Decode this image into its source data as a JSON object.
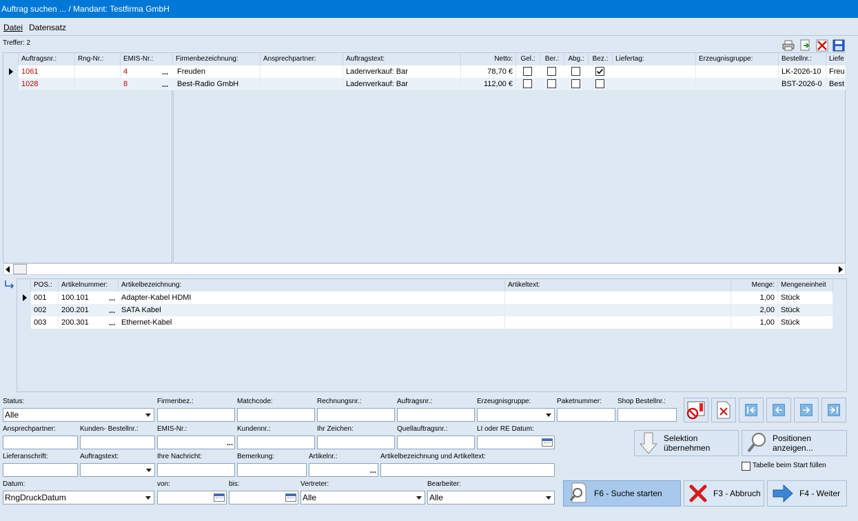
{
  "window": {
    "title": "Auftrag suchen ... / Mandant: Testfirma GmbH"
  },
  "menu": {
    "datei": "Datei",
    "datensatz": "Datensatz"
  },
  "hits": "Treffer: 2",
  "toolbar_icons": [
    "printer-icon",
    "export-icon",
    "delete-icon",
    "save-icon"
  ],
  "orders": {
    "headers": {
      "auftragsnr": "Auftragsnr.:",
      "rngnr": "Rng-Nr.:",
      "emisnr": "EMIS-Nr.:",
      "firma": "Firmenbezeichnung:",
      "ansprechpartner": "Ansprechpartner:",
      "auftragstext": "Auftragstext:",
      "netto": "Netto:",
      "gel": "Gel.:",
      "ber": "Ber.:",
      "abg": "Abg.:",
      "bez": "Bez.:",
      "liefertag": "Liefertag:",
      "erzeugnisgruppe": "Erzeugnisgruppe:",
      "bestellnr": "Bestellnr.:",
      "liefe": "Liefe"
    },
    "rows": [
      {
        "auftragsnr": "1061",
        "rngnr": "",
        "emisnr": "4",
        "ellipsis": "...",
        "firma": "Freuden",
        "ansprechpartner": "",
        "auftragstext": "Ladenverkauf: Bar",
        "netto": "78,70 €",
        "gel": false,
        "ber": false,
        "abg": false,
        "bez": true,
        "liefertag": "",
        "erzeugnisgruppe": "",
        "bestellnr": "LK-2026-10",
        "liefe": "Freu"
      },
      {
        "auftragsnr": "1028",
        "rngnr": "",
        "emisnr": "8",
        "ellipsis": "...",
        "firma": "Best-Radio GmbH",
        "ansprechpartner": "",
        "auftragstext": "Ladenverkauf: Bar",
        "netto": "112,00 €",
        "gel": false,
        "ber": false,
        "abg": false,
        "bez": false,
        "liefertag": "",
        "erzeugnisgruppe": "",
        "bestellnr": "BST-2026-0",
        "liefe": "Best"
      }
    ]
  },
  "positions": {
    "headers": {
      "pos": "POS.:",
      "artikelnummer": "Artikelnummer:",
      "bezeichnung": "Artikelbezeichnung:",
      "artikeltext": "Artikeltext:",
      "menge": "Menge:",
      "einheit": "Mengeneinheit"
    },
    "rows": [
      {
        "pos": "001",
        "artikelnummer": "100.101",
        "ellipsis": "...",
        "bezeichnung": "Adapter-Kabel HDMI",
        "artikeltext": "",
        "menge": "1,00",
        "einheit": "Stück"
      },
      {
        "pos": "002",
        "artikelnummer": "200.201",
        "ellipsis": "...",
        "bezeichnung": "SATA Kabel",
        "artikeltext": "",
        "menge": "2,00",
        "einheit": "Stück"
      },
      {
        "pos": "003",
        "artikelnummer": "200.301",
        "ellipsis": "...",
        "bezeichnung": "Ethernet-Kabel",
        "artikeltext": "",
        "menge": "1,00",
        "einheit": "Stück"
      }
    ]
  },
  "filters": {
    "status": {
      "label": "Status:",
      "value": "Alle"
    },
    "firmenbez": {
      "label": "Firmenbez.:",
      "value": ""
    },
    "matchcode": {
      "label": "Matchcode:",
      "value": ""
    },
    "rechnungsnr": {
      "label": "Rechnungsnr.:",
      "value": ""
    },
    "auftragsnr": {
      "label": "Auftragsnr.:",
      "value": ""
    },
    "erzeugnisgruppe": {
      "label": "Erzeugnisgruppe:",
      "value": ""
    },
    "paketnummer": {
      "label": "Paketnummer:",
      "value": ""
    },
    "shopbestellnr": {
      "label": "Shop Bestellnr.:",
      "value": ""
    },
    "ansprechpartner": {
      "label": "Ansprechpartner:",
      "value": ""
    },
    "kundenbestellnr": {
      "label": "Kunden- Bestellnr.:",
      "value": ""
    },
    "emisnr": {
      "label": "EMIS-Nr.:",
      "value": "",
      "button": "..."
    },
    "kundennr": {
      "label": "Kundennr.:",
      "value": ""
    },
    "ihrzeichen": {
      "label": "Ihr Zeichen:",
      "value": ""
    },
    "quellauftragsnr": {
      "label": "Quellauftragsnr.:",
      "value": ""
    },
    "liredatum": {
      "label": "LI oder RE Datum:",
      "value": ""
    },
    "lieferanschrift": {
      "label": "Lieferanschrift:",
      "value": ""
    },
    "auftragstext": {
      "label": "Auftragstext:",
      "value": ""
    },
    "ihrenachricht": {
      "label": "Ihre Nachricht:",
      "value": ""
    },
    "bemerkung": {
      "label": "Bemerkung:",
      "value": ""
    },
    "artikelnr": {
      "label": "Artikelnr.:",
      "value": "",
      "button": "..."
    },
    "artikelbez": {
      "label": "Artikelbezeichnung und Artikeltext:",
      "value": ""
    },
    "datum": {
      "label": "Datum:",
      "value": "RngDruckDatum"
    },
    "von": {
      "label": "von:",
      "value": ""
    },
    "bis": {
      "label": "bis:",
      "value": ""
    },
    "vertreter": {
      "label": "Vertreter:",
      "value": "Alle"
    },
    "bearbeiter": {
      "label": "Bearbeiter:",
      "value": "Alle"
    }
  },
  "buttons": {
    "selektion": "Selektion\nübernehmen",
    "positionen": "Positionen\nanzeigen...",
    "tabelle_fuellen": "Tabelle beim Start füllen",
    "suche": "F6 - Suche starten",
    "abbruch": "F3 - Abbruch",
    "weiter": "F4 - Weiter"
  },
  "colors": {
    "titlebar": "#0078d7",
    "background": "#dde8f3",
    "red_value": "#c00000",
    "selected_button": "#a8c8ec"
  }
}
